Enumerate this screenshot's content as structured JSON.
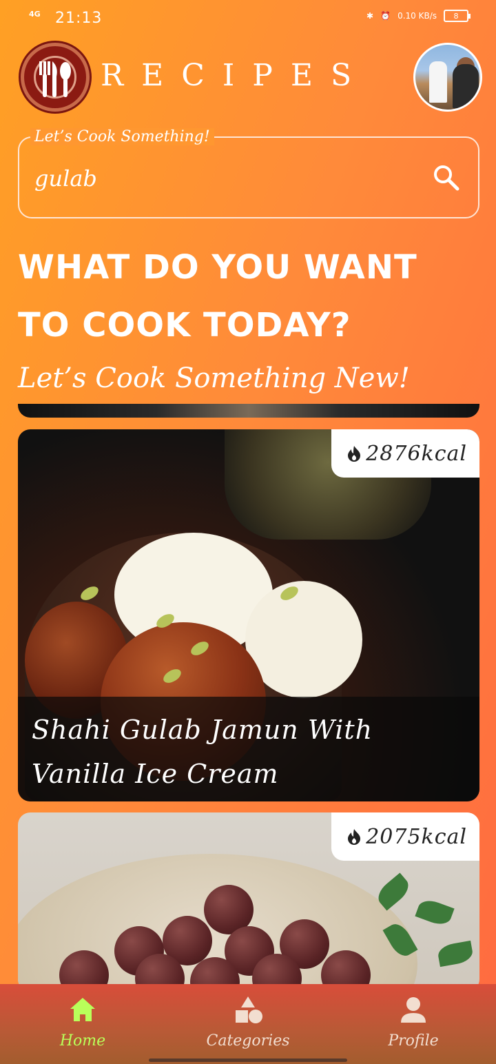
{
  "status_bar": {
    "network": "4G",
    "time": "21:13",
    "speed": "0.10 KB/s",
    "battery": "8"
  },
  "header": {
    "app_title": "RECIPES",
    "logo_icon": "cutlery-logo-icon",
    "avatar_icon": "user-avatar"
  },
  "search": {
    "label": "Let’s Cook Something!",
    "value": "gulab",
    "icon": "search-icon"
  },
  "headline": "WHAT DO YOU WANT TO COOK TODAY?",
  "subheadline": "Let’s Cook Something New!",
  "recipes": [
    {
      "title": "Shahi Gulab Jamun With Vanilla Ice Cream",
      "kcal": "2876kcal"
    },
    {
      "title": "",
      "kcal": "2075kcal"
    }
  ],
  "bottom_nav": {
    "items": [
      {
        "label": "Home",
        "icon": "home-icon",
        "active": true
      },
      {
        "label": "Categories",
        "icon": "categories-icon",
        "active": false
      },
      {
        "label": "Profile",
        "icon": "profile-icon",
        "active": false
      }
    ],
    "active_color": "#b9ff5a"
  }
}
